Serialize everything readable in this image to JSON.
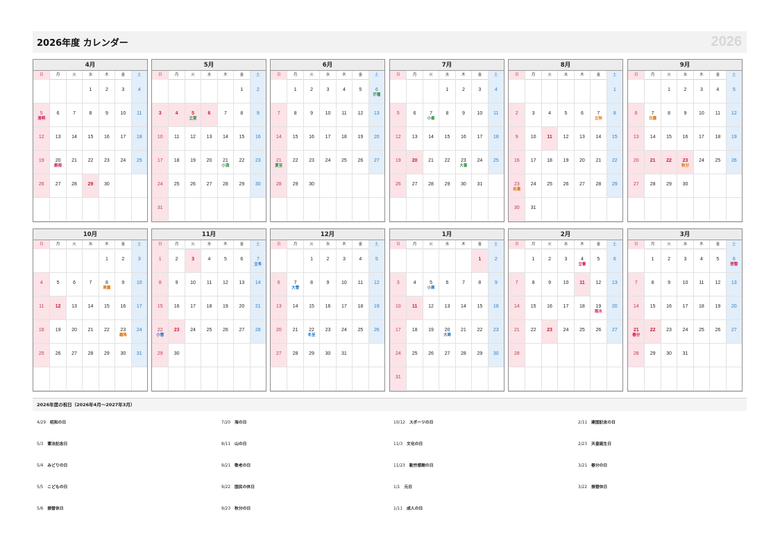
{
  "title": "2026年度 カレンダー",
  "year": "2026",
  "weekdays": [
    "日",
    "月",
    "火",
    "水",
    "木",
    "金",
    "土"
  ],
  "months": [
    {
      "name": "4月",
      "start": 3,
      "days": 30,
      "holidays": [
        29
      ],
      "sekki": [
        {
          "day": 5,
          "label": "清明",
          "color": "red"
        },
        {
          "day": 20,
          "label": "穀雨",
          "color": "red"
        }
      ]
    },
    {
      "name": "5月",
      "start": 5,
      "days": 31,
      "holidays": [
        3,
        4,
        5,
        6
      ],
      "sekki": [
        {
          "day": 5,
          "label": "立夏",
          "color": "green"
        },
        {
          "day": 21,
          "label": "小満",
          "color": "green"
        }
      ]
    },
    {
      "name": "6月",
      "start": 1,
      "days": 30,
      "holidays": [],
      "sekki": [
        {
          "day": 6,
          "label": "芒種",
          "color": "green"
        },
        {
          "day": 21,
          "label": "夏至",
          "color": "green"
        }
      ]
    },
    {
      "name": "7月",
      "start": 3,
      "days": 31,
      "holidays": [
        20
      ],
      "sekki": [
        {
          "day": 7,
          "label": "小暑",
          "color": "green"
        },
        {
          "day": 23,
          "label": "大暑",
          "color": "green"
        }
      ]
    },
    {
      "name": "8月",
      "start": 6,
      "days": 31,
      "holidays": [
        11
      ],
      "sekki": [
        {
          "day": 7,
          "label": "立秋",
          "color": "orange"
        },
        {
          "day": 23,
          "label": "処暑",
          "color": "orange"
        }
      ]
    },
    {
      "name": "9月",
      "start": 2,
      "days": 30,
      "holidays": [
        21,
        22,
        23
      ],
      "sekki": [
        {
          "day": 7,
          "label": "白露",
          "color": "orange"
        },
        {
          "day": 23,
          "label": "秋分",
          "color": "orange"
        }
      ]
    },
    {
      "name": "10月",
      "start": 4,
      "days": 31,
      "holidays": [
        12
      ],
      "sekki": [
        {
          "day": 8,
          "label": "寒露",
          "color": "orange"
        },
        {
          "day": 23,
          "label": "霜降",
          "color": "orange"
        }
      ]
    },
    {
      "name": "11月",
      "start": 0,
      "days": 30,
      "holidays": [
        3,
        23
      ],
      "sekki": [
        {
          "day": 7,
          "label": "立冬",
          "color": "blue"
        },
        {
          "day": 22,
          "label": "小雪",
          "color": "blue"
        }
      ]
    },
    {
      "name": "12月",
      "start": 2,
      "days": 31,
      "holidays": [],
      "sekki": [
        {
          "day": 7,
          "label": "大雪",
          "color": "blue"
        },
        {
          "day": 22,
          "label": "冬至",
          "color": "blue"
        }
      ]
    },
    {
      "name": "1月",
      "start": 5,
      "days": 31,
      "holidays": [
        1,
        11
      ],
      "sekki": [
        {
          "day": 5,
          "label": "小寒",
          "color": "blue"
        },
        {
          "day": 20,
          "label": "大寒",
          "color": "blue"
        }
      ]
    },
    {
      "name": "2月",
      "start": 1,
      "days": 28,
      "holidays": [
        11,
        23
      ],
      "sekki": [
        {
          "day": 4,
          "label": "立春",
          "color": "red"
        },
        {
          "day": 19,
          "label": "雨水",
          "color": "red"
        }
      ]
    },
    {
      "name": "3月",
      "start": 1,
      "days": 31,
      "holidays": [
        21,
        22
      ],
      "sekki": [
        {
          "day": 6,
          "label": "啓蟄",
          "color": "red"
        },
        {
          "day": 21,
          "label": "春分",
          "color": "red"
        }
      ]
    }
  ],
  "holiday_title": "2026年度の祝日（2026年4月～2027年3月）",
  "holiday_list": [
    [
      {
        "date": "4/29",
        "name": "昭和の日"
      },
      {
        "date": "5/3",
        "name": "憲法記念日"
      },
      {
        "date": "5/4",
        "name": "みどりの日"
      },
      {
        "date": "5/5",
        "name": "こどもの日"
      },
      {
        "date": "5/6",
        "name": "振替休日"
      }
    ],
    [
      {
        "date": "7/20",
        "name": "海の日"
      },
      {
        "date": "8/11",
        "name": "山の日"
      },
      {
        "date": "9/21",
        "name": "敬老の日"
      },
      {
        "date": "9/22",
        "name": "国民の休日"
      },
      {
        "date": "9/23",
        "name": "秋分の日"
      }
    ],
    [
      {
        "date": "10/12",
        "name": "スポーツの日"
      },
      {
        "date": "11/3",
        "name": "文化の日"
      },
      {
        "date": "11/23",
        "name": "勤労感謝の日"
      },
      {
        "date": "1/1",
        "name": "元日"
      },
      {
        "date": "1/11",
        "name": "成人の日"
      }
    ],
    [
      {
        "date": "2/11",
        "name": "建国記念の日"
      },
      {
        "date": "2/23",
        "name": "天皇誕生日"
      },
      {
        "date": "3/21",
        "name": "春分の日"
      },
      {
        "date": "3/22",
        "name": "振替休日"
      }
    ]
  ]
}
